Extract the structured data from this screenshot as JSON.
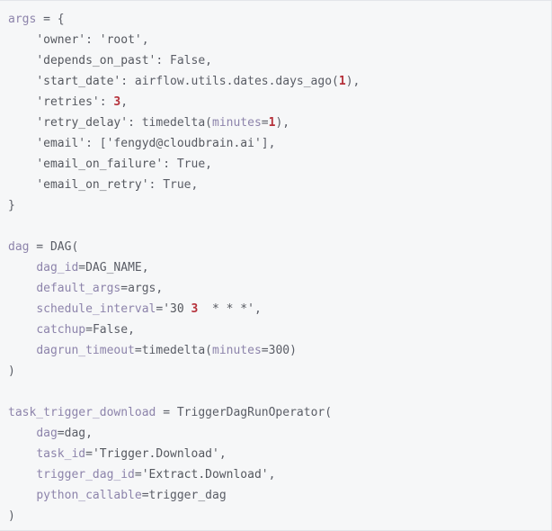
{
  "code_block": {
    "language": "python",
    "background_color": "#f6f7f8",
    "border_color": "#e3e6ea",
    "colors": {
      "default": "#5a5d66",
      "identifier": "#8d84ab",
      "string": "#55585f",
      "number": "#b5303a",
      "keyword": "#5a5d66"
    },
    "lines": [
      {
        "id": "line-1",
        "tokens": [
          {
            "t": "args",
            "c": "name"
          },
          {
            "t": " = {",
            "c": "def"
          }
        ]
      },
      {
        "id": "line-2",
        "tokens": [
          {
            "t": "    ",
            "c": "def"
          },
          {
            "t": "'owner'",
            "c": "str"
          },
          {
            "t": ": ",
            "c": "def"
          },
          {
            "t": "'root'",
            "c": "str"
          },
          {
            "t": ",",
            "c": "def"
          }
        ]
      },
      {
        "id": "line-3",
        "tokens": [
          {
            "t": "    ",
            "c": "def"
          },
          {
            "t": "'depends_on_past'",
            "c": "str"
          },
          {
            "t": ": ",
            "c": "def"
          },
          {
            "t": "False",
            "c": "kw"
          },
          {
            "t": ",",
            "c": "def"
          }
        ]
      },
      {
        "id": "line-4",
        "tokens": [
          {
            "t": "    ",
            "c": "def"
          },
          {
            "t": "'start_date'",
            "c": "str"
          },
          {
            "t": ": ",
            "c": "def"
          },
          {
            "t": "airflow.utils.dates.days_ago(",
            "c": "plain"
          },
          {
            "t": "1",
            "c": "num"
          },
          {
            "t": "),",
            "c": "def"
          }
        ]
      },
      {
        "id": "line-5",
        "tokens": [
          {
            "t": "    ",
            "c": "def"
          },
          {
            "t": "'retries'",
            "c": "str"
          },
          {
            "t": ": ",
            "c": "def"
          },
          {
            "t": "3",
            "c": "num"
          },
          {
            "t": ",",
            "c": "def"
          }
        ]
      },
      {
        "id": "line-6",
        "tokens": [
          {
            "t": "    ",
            "c": "def"
          },
          {
            "t": "'retry_delay'",
            "c": "str"
          },
          {
            "t": ": ",
            "c": "def"
          },
          {
            "t": "timedelta(",
            "c": "plain"
          },
          {
            "t": "minutes",
            "c": "name"
          },
          {
            "t": "=",
            "c": "def"
          },
          {
            "t": "1",
            "c": "num"
          },
          {
            "t": "),",
            "c": "def"
          }
        ]
      },
      {
        "id": "line-7",
        "tokens": [
          {
            "t": "    ",
            "c": "def"
          },
          {
            "t": "'email'",
            "c": "str"
          },
          {
            "t": ": [",
            "c": "def"
          },
          {
            "t": "'fengyd@cloudbrain.ai'",
            "c": "str"
          },
          {
            "t": "],",
            "c": "def"
          }
        ]
      },
      {
        "id": "line-8",
        "tokens": [
          {
            "t": "    ",
            "c": "def"
          },
          {
            "t": "'email_on_failure'",
            "c": "str"
          },
          {
            "t": ": ",
            "c": "def"
          },
          {
            "t": "True",
            "c": "kw"
          },
          {
            "t": ",",
            "c": "def"
          }
        ]
      },
      {
        "id": "line-9",
        "tokens": [
          {
            "t": "    ",
            "c": "def"
          },
          {
            "t": "'email_on_retry'",
            "c": "str"
          },
          {
            "t": ": ",
            "c": "def"
          },
          {
            "t": "True",
            "c": "kw"
          },
          {
            "t": ",",
            "c": "def"
          }
        ]
      },
      {
        "id": "line-10",
        "tokens": [
          {
            "t": "}",
            "c": "def"
          }
        ]
      },
      {
        "id": "line-11",
        "tokens": [
          {
            "t": "",
            "c": "def"
          }
        ]
      },
      {
        "id": "line-12",
        "tokens": [
          {
            "t": "dag",
            "c": "name"
          },
          {
            "t": " = ",
            "c": "def"
          },
          {
            "t": "DAG(",
            "c": "plain"
          }
        ]
      },
      {
        "id": "line-13",
        "tokens": [
          {
            "t": "    ",
            "c": "def"
          },
          {
            "t": "dag_id",
            "c": "name"
          },
          {
            "t": "=",
            "c": "def"
          },
          {
            "t": "DAG_NAME",
            "c": "plain"
          },
          {
            "t": ",",
            "c": "def"
          }
        ]
      },
      {
        "id": "line-14",
        "tokens": [
          {
            "t": "    ",
            "c": "def"
          },
          {
            "t": "default_args",
            "c": "name"
          },
          {
            "t": "=",
            "c": "def"
          },
          {
            "t": "args",
            "c": "plain"
          },
          {
            "t": ",",
            "c": "def"
          }
        ]
      },
      {
        "id": "line-15",
        "tokens": [
          {
            "t": "    ",
            "c": "def"
          },
          {
            "t": "schedule_interval",
            "c": "name"
          },
          {
            "t": "=",
            "c": "def"
          },
          {
            "t": "'30 ",
            "c": "str"
          },
          {
            "t": "3",
            "c": "num"
          },
          {
            "t": "  * * *'",
            "c": "str"
          },
          {
            "t": ",",
            "c": "def"
          }
        ]
      },
      {
        "id": "line-16",
        "tokens": [
          {
            "t": "    ",
            "c": "def"
          },
          {
            "t": "catchup",
            "c": "name"
          },
          {
            "t": "=",
            "c": "def"
          },
          {
            "t": "False",
            "c": "kw"
          },
          {
            "t": ",",
            "c": "def"
          }
        ]
      },
      {
        "id": "line-17",
        "tokens": [
          {
            "t": "    ",
            "c": "def"
          },
          {
            "t": "dagrun_timeout",
            "c": "name"
          },
          {
            "t": "=",
            "c": "def"
          },
          {
            "t": "timedelta(",
            "c": "plain"
          },
          {
            "t": "minutes",
            "c": "name"
          },
          {
            "t": "=300)",
            "c": "plain"
          }
        ]
      },
      {
        "id": "line-18",
        "tokens": [
          {
            "t": ")",
            "c": "def"
          }
        ]
      },
      {
        "id": "line-19",
        "tokens": [
          {
            "t": "",
            "c": "def"
          }
        ]
      },
      {
        "id": "line-20",
        "tokens": [
          {
            "t": "task_trigger_download",
            "c": "name"
          },
          {
            "t": " = ",
            "c": "def"
          },
          {
            "t": "TriggerDagRunOperator(",
            "c": "plain"
          }
        ]
      },
      {
        "id": "line-21",
        "tokens": [
          {
            "t": "    ",
            "c": "def"
          },
          {
            "t": "dag",
            "c": "name"
          },
          {
            "t": "=",
            "c": "def"
          },
          {
            "t": "dag",
            "c": "plain"
          },
          {
            "t": ",",
            "c": "def"
          }
        ]
      },
      {
        "id": "line-22",
        "tokens": [
          {
            "t": "    ",
            "c": "def"
          },
          {
            "t": "task_id",
            "c": "name"
          },
          {
            "t": "=",
            "c": "def"
          },
          {
            "t": "'Trigger.Download'",
            "c": "str"
          },
          {
            "t": ",",
            "c": "def"
          }
        ]
      },
      {
        "id": "line-23",
        "tokens": [
          {
            "t": "    ",
            "c": "def"
          },
          {
            "t": "trigger_dag_id",
            "c": "name"
          },
          {
            "t": "=",
            "c": "def"
          },
          {
            "t": "'Extract.Download'",
            "c": "str"
          },
          {
            "t": ",",
            "c": "def"
          }
        ]
      },
      {
        "id": "line-24",
        "tokens": [
          {
            "t": "    ",
            "c": "def"
          },
          {
            "t": "python_callable",
            "c": "name"
          },
          {
            "t": "=",
            "c": "def"
          },
          {
            "t": "trigger_dag",
            "c": "plain"
          }
        ]
      },
      {
        "id": "line-25",
        "tokens": [
          {
            "t": ")",
            "c": "def"
          }
        ]
      }
    ]
  }
}
